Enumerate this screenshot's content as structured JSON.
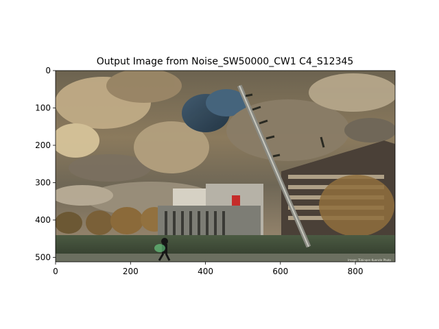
{
  "figure": {
    "title": "Output Image from Noise_SW50000_CW1 C4_S12345",
    "image_description_icon": "stylized-photo-icon",
    "x_axis": {
      "ticks": [
        0,
        200,
        400,
        600,
        800
      ],
      "range": [
        0,
        906
      ]
    },
    "y_axis": {
      "ticks": [
        0,
        100,
        200,
        300,
        400,
        500
      ],
      "range": [
        0,
        512
      ]
    },
    "corner_watermark": "Image: Tübingen Kuenzle Photo"
  }
}
